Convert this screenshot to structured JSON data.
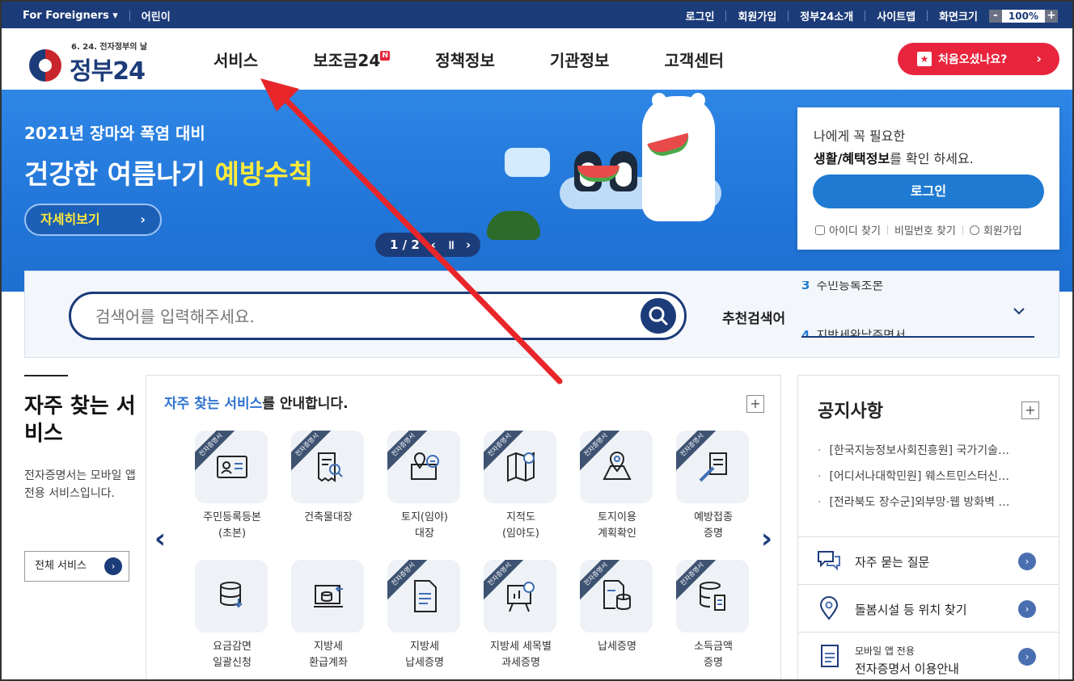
{
  "topbar": {
    "for_foreigners": "For Foreigners ▾",
    "kids": "어린이",
    "links": [
      "로그인",
      "회원가입",
      "정부24소개",
      "사이트맵",
      "화면크기"
    ],
    "zoom_minus": "-",
    "zoom_value": "100%",
    "zoom_plus": "+"
  },
  "header": {
    "logo_sub": "6. 24. 전자정부의 날",
    "logo_name": "정부24",
    "nav": [
      "서비스",
      "보조금24",
      "정책정보",
      "기관정보",
      "고객센터"
    ],
    "new_badge": "N",
    "first_visit": "처음오셨나요?",
    "first_visit_arrow": "›"
  },
  "banner": {
    "subtitle": "2021년 장마와 폭염 대비",
    "title_main": "건강한 여름나기 ",
    "title_highlight": "예방수칙",
    "more_button": "자세히보기",
    "more_arrow": "›",
    "pager": "1 / 2"
  },
  "login": {
    "line1": "나에게 꼭 필요한",
    "line2_bold": "생활/혜택정보",
    "line2_rest": "를 확인 하세요.",
    "login_button": "로그인",
    "find_id": "아이디 찾기",
    "find_pw": "비밀번호 찾기",
    "signup": "회원가입"
  },
  "search": {
    "placeholder": "검색어를 입력해주세요.",
    "recommend_label": "추천검색어",
    "recommend": [
      {
        "num": "3",
        "text": "주민등록초본"
      },
      {
        "num": "4",
        "text": "지방세완납증명서"
      }
    ]
  },
  "leftcol": {
    "title": "자주 찾는 서비스",
    "description": "전자증명서는 모바일 앱 전용 서비스입니다.",
    "all_button": "전체 서비스",
    "all_arrow": "›"
  },
  "services": {
    "heading_highlight": "자주 찾는 서비스",
    "heading_rest": "를 안내합니다.",
    "plus": "+",
    "prev": "‹",
    "next": "›",
    "ribbon": "전자증명서",
    "items": [
      {
        "label1": "주민등록등본",
        "label2": "(초본)",
        "ribbon": true
      },
      {
        "label1": "건축물대장",
        "label2": "",
        "ribbon": true
      },
      {
        "label1": "토지(임야)",
        "label2": "대장",
        "ribbon": true
      },
      {
        "label1": "지적도",
        "label2": "(임야도)",
        "ribbon": true
      },
      {
        "label1": "토지이용",
        "label2": "계획확인",
        "ribbon": true
      },
      {
        "label1": "예방접종",
        "label2": "증명",
        "ribbon": true
      },
      {
        "label1": "요금감면",
        "label2": "일괄신청",
        "ribbon": false
      },
      {
        "label1": "지방세",
        "label2": "환급계좌",
        "ribbon": false
      },
      {
        "label1": "지방세",
        "label2": "납세증명",
        "ribbon": true
      },
      {
        "label1": "지방세 세목별",
        "label2": "과세증명",
        "ribbon": true
      },
      {
        "label1": "납세증명",
        "label2": "",
        "ribbon": true
      },
      {
        "label1": "소득금액",
        "label2": "증명",
        "ribbon": true
      }
    ]
  },
  "notices": {
    "title": "공지사항",
    "plus": "+",
    "items": [
      "[한국지능정보사회진흥원] 국가기술…",
      "[어디서나대학민원] 웨스트민스터신…",
      "[전라북도 장수군]외부망·웹 방화벽 …"
    ]
  },
  "quick": {
    "faq": "자주 묻는 질문",
    "facility": "돌봄시설 등 위치 찾기",
    "app_small": "모바일 앱 전용",
    "app_big": "전자증명서 이용안내",
    "go": "›"
  },
  "colors": {
    "navy": "#1c3b79",
    "red": "#e8253d",
    "blue": "#1f7bd2",
    "banner": "#2276d9",
    "highlight_yellow": "#ffea3a",
    "annotation_arrow": "#e8262a"
  }
}
